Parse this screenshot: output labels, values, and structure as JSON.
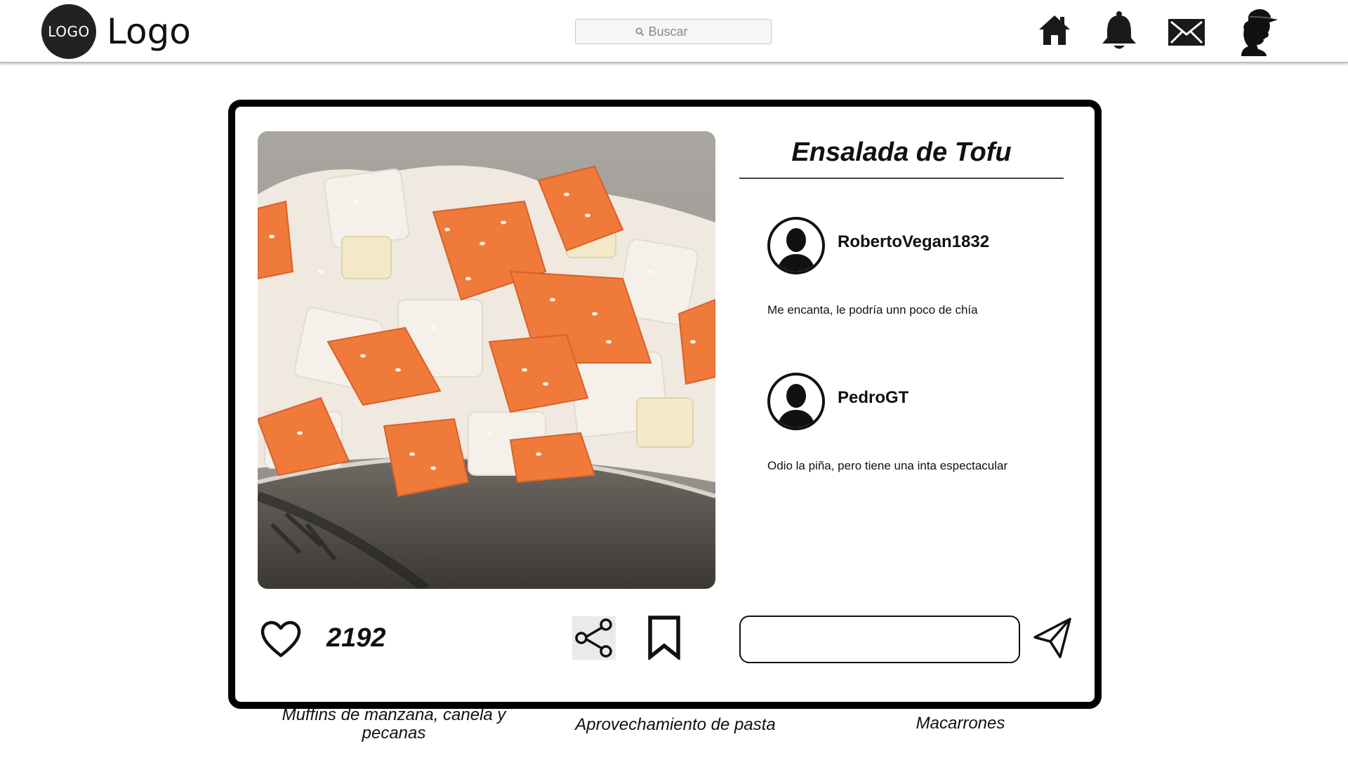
{
  "header": {
    "logo_badge": "LOGO",
    "logo_text": "Logo",
    "search_placeholder": "Buscar",
    "nav_icons": [
      "home-icon",
      "bell-icon",
      "mail-icon",
      "profile-icon"
    ]
  },
  "post": {
    "title": "Ensalada de Tofu",
    "likes": "2192",
    "image": "tofu-salad-photo",
    "comment_input_value": "",
    "comments": [
      {
        "user": "RobertoVegan1832",
        "text": "Me encanta, le podría unn poco de chía"
      },
      {
        "user": "PedroGT",
        "text": "Odio la piña, pero tiene una inta espectacular"
      }
    ]
  },
  "captions": [
    "Muffins de manzana, canela y pecanas",
    "Aprovechamiento de pasta",
    "Macarrones"
  ],
  "colors": {
    "accent": "#000000",
    "carrot": "#f07a3a",
    "tofu": "#f2ede4",
    "bowl": "#56524c"
  }
}
